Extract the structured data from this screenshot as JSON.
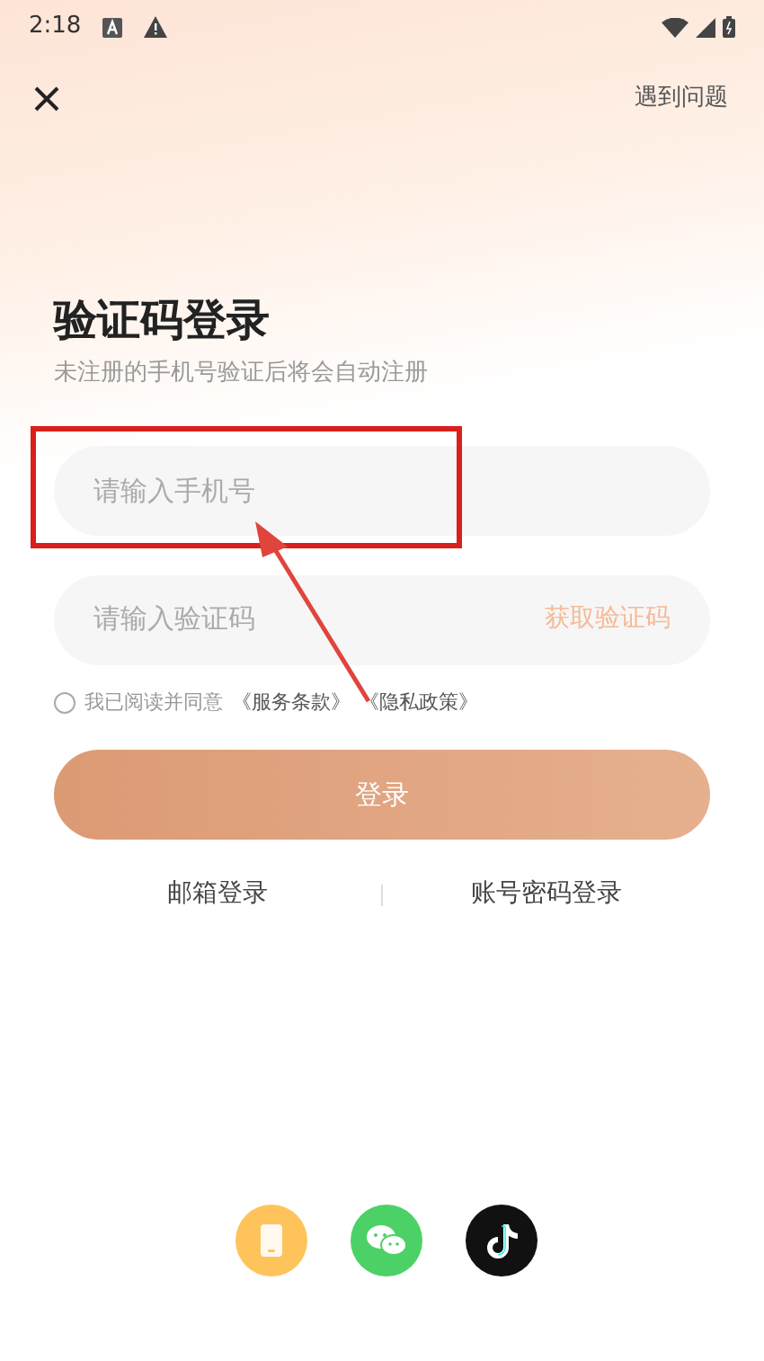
{
  "status_bar": {
    "time": "2:18"
  },
  "header": {
    "help_link": "遇到问题"
  },
  "title": "验证码登录",
  "subtitle": "未注册的手机号验证后将会自动注册",
  "phone_field": {
    "placeholder": "请输入手机号"
  },
  "code_field": {
    "placeholder": "请输入验证码",
    "action": "获取验证码"
  },
  "agreement": {
    "checked": false,
    "text": "我已阅读并同意",
    "links": [
      "《服务条款》",
      "《隐私政策》"
    ]
  },
  "login_button": {
    "label": "登录",
    "disabled": true
  },
  "alt_logins": [
    "邮箱登录",
    "账号密码登录"
  ],
  "social_logins": [
    {
      "kind": "phone",
      "color": "#ffc35c"
    },
    {
      "kind": "wechat",
      "color": "#4cd166"
    },
    {
      "kind": "tiktok",
      "color": "#111111"
    }
  ],
  "annotation": {
    "kind": "highlight"
  }
}
